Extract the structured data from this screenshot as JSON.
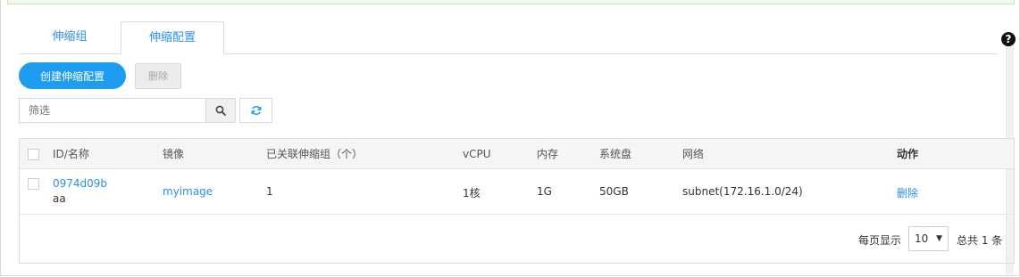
{
  "tabs": [
    {
      "label": "伸缩组"
    },
    {
      "label": "伸缩配置"
    }
  ],
  "help": {
    "glyph": "?"
  },
  "toolbar": {
    "create_label": "创建伸缩配置",
    "delete_label": "删除"
  },
  "filter": {
    "placeholder": "筛选",
    "value": ""
  },
  "table": {
    "columns": [
      "ID/名称",
      "镜像",
      "已关联伸缩组（个）",
      "vCPU",
      "内存",
      "系统盘",
      "网络",
      "动作"
    ],
    "rows": [
      {
        "id": "0974d09b",
        "name": "aa",
        "image": "myimage",
        "groups": "1",
        "vcpu": "1核",
        "memory": "1G",
        "disk": "50GB",
        "network": "subnet(172.16.1.0/24)",
        "action": "删除"
      }
    ]
  },
  "pagination": {
    "per_page_label": "每页显示",
    "per_page_value": "10",
    "total_label": "总共 1 条"
  },
  "colors": {
    "accent": "#1e9cf0",
    "link": "#2c8fe3"
  }
}
